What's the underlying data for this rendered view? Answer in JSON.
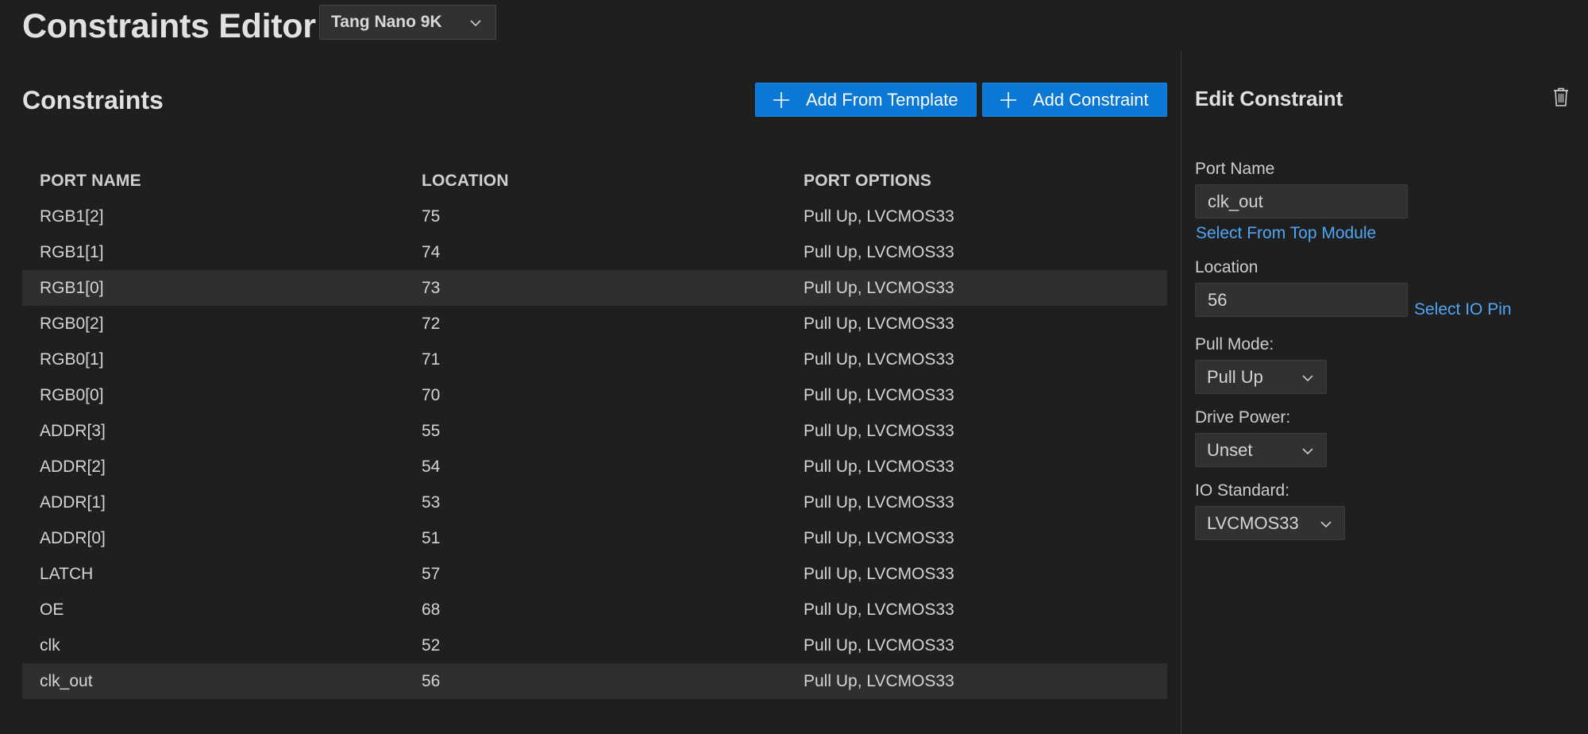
{
  "header": {
    "title": "Constraints Editor",
    "board_select": "Tang Nano 9K"
  },
  "constraints": {
    "title": "Constraints",
    "add_from_template_label": "Add From Template",
    "add_constraint_label": "Add Constraint",
    "columns": [
      "PORT NAME",
      "LOCATION",
      "PORT OPTIONS"
    ],
    "rows": [
      {
        "port": "RGB1[2]",
        "location": "75",
        "options": "Pull Up, LVCMOS33"
      },
      {
        "port": "RGB1[1]",
        "location": "74",
        "options": "Pull Up, LVCMOS33"
      },
      {
        "port": "RGB1[0]",
        "location": "73",
        "options": "Pull Up, LVCMOS33"
      },
      {
        "port": "RGB0[2]",
        "location": "72",
        "options": "Pull Up, LVCMOS33"
      },
      {
        "port": "RGB0[1]",
        "location": "71",
        "options": "Pull Up, LVCMOS33"
      },
      {
        "port": "RGB0[0]",
        "location": "70",
        "options": "Pull Up, LVCMOS33"
      },
      {
        "port": "ADDR[3]",
        "location": "55",
        "options": "Pull Up, LVCMOS33"
      },
      {
        "port": "ADDR[2]",
        "location": "54",
        "options": "Pull Up, LVCMOS33"
      },
      {
        "port": "ADDR[1]",
        "location": "53",
        "options": "Pull Up, LVCMOS33"
      },
      {
        "port": "ADDR[0]",
        "location": "51",
        "options": "Pull Up, LVCMOS33"
      },
      {
        "port": "LATCH",
        "location": "57",
        "options": "Pull Up, LVCMOS33"
      },
      {
        "port": "OE",
        "location": "68",
        "options": "Pull Up, LVCMOS33"
      },
      {
        "port": "clk",
        "location": "52",
        "options": "Pull Up, LVCMOS33"
      },
      {
        "port": "clk_out",
        "location": "56",
        "options": "Pull Up, LVCMOS33"
      }
    ]
  },
  "edit": {
    "title": "Edit Constraint",
    "port_name_label": "Port Name",
    "port_name_value": "clk_out",
    "select_from_top_module": "Select From Top Module",
    "location_label": "Location",
    "location_value": "56",
    "select_io_pin": "Select IO Pin",
    "pull_mode_label": "Pull Mode:",
    "pull_mode_value": "Pull Up",
    "drive_power_label": "Drive Power:",
    "drive_power_value": "Unset",
    "io_standard_label": "IO Standard:",
    "io_standard_value": "LVCMOS33"
  },
  "colors": {
    "background": "#1f1f1f",
    "button_blue": "#0a78d4",
    "link_blue": "#4fa6f5",
    "selected_row": "#2f2f2f"
  },
  "icons": [
    "chevron-down-icon",
    "plus-icon",
    "trash-icon"
  ]
}
